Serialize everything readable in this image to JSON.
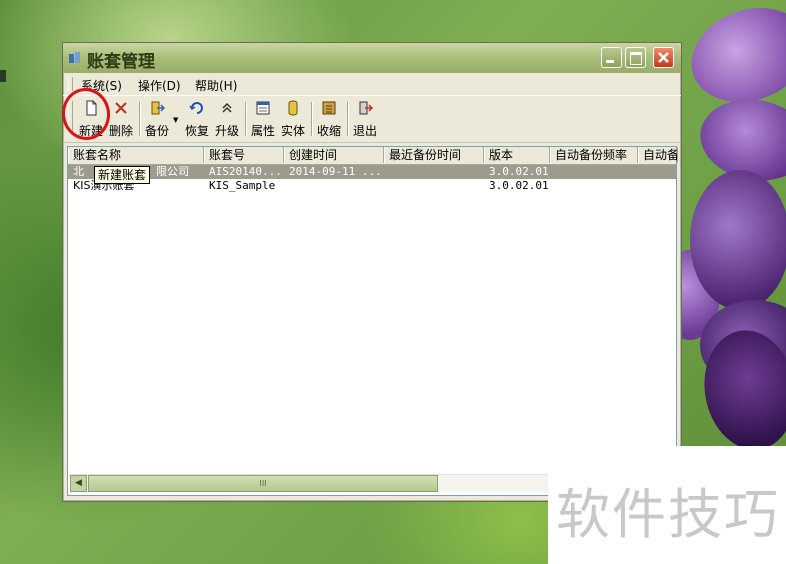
{
  "window": {
    "title": "账套管理"
  },
  "menu": [
    {
      "label": "系统(S)"
    },
    {
      "label": "操作(D)"
    },
    {
      "label": "帮助(H)"
    }
  ],
  "toolbar": [
    {
      "label": "新建",
      "icon": "new-file-icon"
    },
    {
      "label": "删除",
      "icon": "delete-x-icon"
    },
    {
      "label": "备份",
      "icon": "backup-icon"
    },
    {
      "label": "恢复",
      "icon": "restore-icon"
    },
    {
      "label": "升级",
      "icon": "upgrade-icon"
    },
    {
      "label": "属性",
      "icon": "properties-icon"
    },
    {
      "label": "实体",
      "icon": "entity-icon"
    },
    {
      "label": "收缩",
      "icon": "collapse-icon"
    },
    {
      "label": "退出",
      "icon": "exit-icon"
    }
  ],
  "table": {
    "columns": [
      "账套名称",
      "账套号",
      "创建时间",
      "最近备份时间",
      "版本",
      "自动备份频率",
      "自动备"
    ],
    "rows": [
      {
        "name": "北",
        "name_suffix": "限公司",
        "id": "AIS20140...",
        "created": "2014-09-11 ...",
        "last_backup": "",
        "version": "3.0.02.01",
        "freq": "",
        "auto": ""
      },
      {
        "name": "KIS演示账套",
        "name_suffix": "",
        "id": "KIS_Sample",
        "created": "",
        "last_backup": "",
        "version": "3.0.02.01",
        "freq": "",
        "auto": ""
      }
    ]
  },
  "tooltip": "新建账套",
  "scroll": {
    "thumb_grip": "III"
  },
  "watermark": "软件技巧",
  "colors": {
    "annotation_circle": "#d8141b",
    "selection": "#9b9b8e"
  }
}
